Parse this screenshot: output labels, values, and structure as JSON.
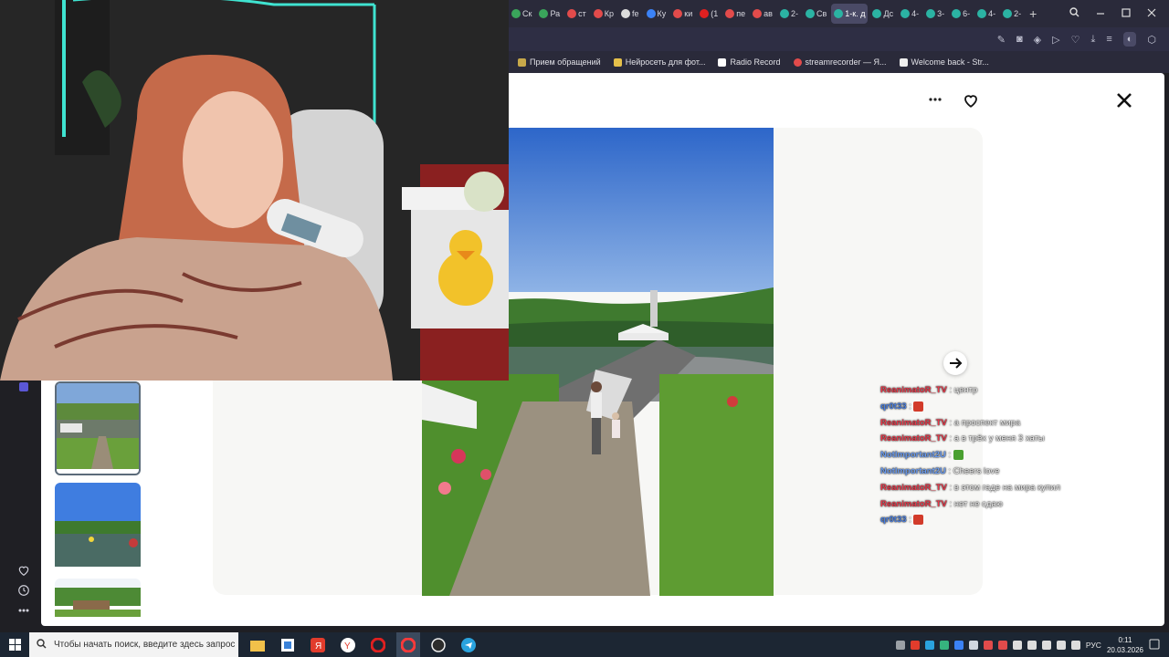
{
  "browser": {
    "tabs": [
      {
        "label": "Ск",
        "color": "#3aa55b"
      },
      {
        "label": "Ра",
        "color": "#3aa55b"
      },
      {
        "label": "ст",
        "color": "#e24b4b"
      },
      {
        "label": "Кр",
        "color": "#e24b4b"
      },
      {
        "label": "fe",
        "color": "#dddddd"
      },
      {
        "label": "Ку",
        "color": "#3b82f6"
      },
      {
        "label": "ки",
        "color": "#e24b4b"
      },
      {
        "label": "(1",
        "color": "#e02020"
      },
      {
        "label": "пе",
        "color": "#e24b4b"
      },
      {
        "label": "ав",
        "color": "#e24b4b"
      },
      {
        "label": "2-",
        "color": "#2bb3a3"
      },
      {
        "label": "Св",
        "color": "#2bb3a3"
      },
      {
        "label": "1-к. д",
        "color": "#2bb3a3",
        "active": true
      },
      {
        "label": "Дс",
        "color": "#2bb3a3"
      },
      {
        "label": "4-",
        "color": "#2bb3a3"
      },
      {
        "label": "3-",
        "color": "#2bb3a3"
      },
      {
        "label": "6-",
        "color": "#2bb3a3"
      },
      {
        "label": "4-",
        "color": "#2bb3a3"
      },
      {
        "label": "2-",
        "color": "#2bb3a3"
      }
    ],
    "new_tab": "+",
    "bookmarks": [
      {
        "label": "Прием обращений",
        "color": "#c7a84a"
      },
      {
        "label": "Нейросеть для фот...",
        "color": "#e5c04a"
      },
      {
        "label": "Radio Record",
        "color": "#ffffff"
      },
      {
        "label": "streamrecorder — Я...",
        "color": "#e24b4b"
      },
      {
        "label": "Welcome back - Str...",
        "color": "#eeeeee"
      }
    ]
  },
  "viewer": {
    "menu_icon": "more-horizontal-icon",
    "favorite_icon": "heart-icon",
    "close_icon": "close-icon",
    "next_icon": "arrow-right-icon"
  },
  "chat": {
    "messages": [
      {
        "user": "ReanimatoR_TV",
        "color": "#e8394a",
        "text": "центр"
      },
      {
        "user": "qr0t33",
        "color": "#4a7fe0",
        "text": "",
        "emote": "#d23b2a"
      },
      {
        "user": "ReanimatoR_TV",
        "color": "#e8394a",
        "text": "а проспект мира"
      },
      {
        "user": "ReanimatoR_TV",
        "color": "#e8394a",
        "text": "а в трёх у меня 3 хаты"
      },
      {
        "user": "NotImportant2U",
        "color": "#6b9cf0",
        "text": "",
        "emote": "#4aa030"
      },
      {
        "user": "NotImportant2U",
        "color": "#6b9cf0",
        "text": "Cheers love"
      },
      {
        "user": "ReanimatoR_TV",
        "color": "#e8394a",
        "text": "в этом гаде на мира купил"
      },
      {
        "user": "ReanimatoR_TV",
        "color": "#e8394a",
        "text": "нет не сдаю"
      },
      {
        "user": "qr0t33",
        "color": "#4a7fe0",
        "text": "",
        "emote": "#d23b2a"
      }
    ]
  },
  "taskbar": {
    "search_placeholder": "Чтобы начать поиск, введите здесь запрос",
    "language": "РУС",
    "time": "0:11",
    "date": "20.03.2026"
  }
}
